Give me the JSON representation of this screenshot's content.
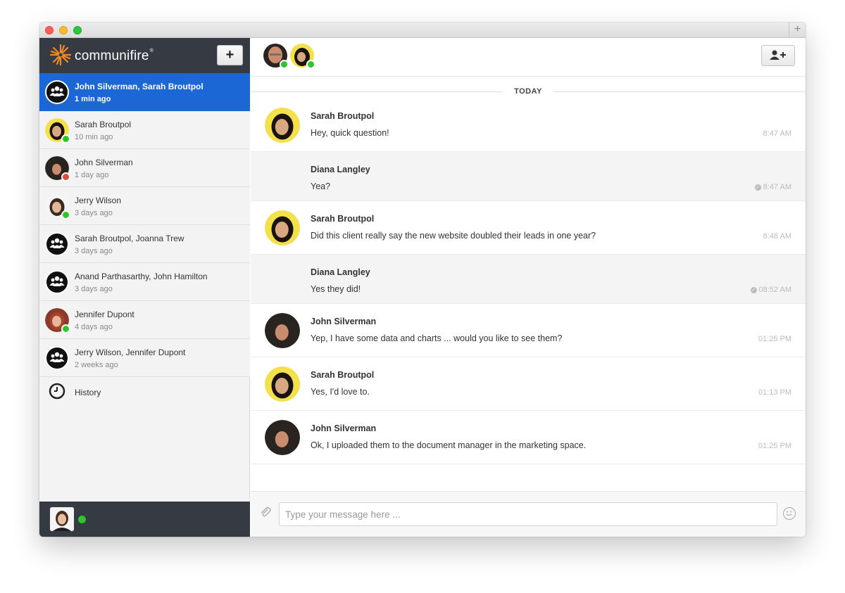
{
  "app": {
    "name": "communifire",
    "trademark": "®"
  },
  "colors": {
    "accent": "#1b67d6",
    "sidebar_dark": "#363b43",
    "online": "#2ec42e",
    "busy": "#e04a3a",
    "logo": "#f08a24"
  },
  "sidebar": {
    "add_label": "+",
    "conversations": [
      {
        "name": "John Silverman, Sarah Broutpol",
        "time": "1 min ago",
        "type": "group",
        "active": true
      },
      {
        "name": "Sarah Broutpol",
        "time": "10 min ago",
        "type": "person",
        "status": "online"
      },
      {
        "name": "John Silverman",
        "time": "1 day ago",
        "type": "person",
        "status": "busy"
      },
      {
        "name": "Jerry Wilson",
        "time": "3 days ago",
        "type": "person",
        "status": "online"
      },
      {
        "name": "Sarah Broutpol, Joanna Trew",
        "time": "3 days ago",
        "type": "group"
      },
      {
        "name": "Anand Parthasarthy, John Hamilton",
        "time": "3 days ago",
        "type": "group"
      },
      {
        "name": "Jennifer Dupont",
        "time": "4 days ago",
        "type": "person",
        "status": "online"
      },
      {
        "name": "Jerry Wilson, Jennifer Dupont",
        "time": "2 weeks ago",
        "type": "group"
      }
    ],
    "history_label": "History",
    "me_status": "online"
  },
  "chat": {
    "add_participant_icon": "add-user-icon",
    "date_divider": "TODAY",
    "messages": [
      {
        "sender": "Sarah Broutpol",
        "text": "Hey, quick question!",
        "time": "8:47 AM",
        "avatar": true,
        "alt": false,
        "read": false
      },
      {
        "sender": "Diana Langley",
        "text": "Yea?",
        "time": "8:47 AM",
        "avatar": false,
        "alt": true,
        "read": true
      },
      {
        "sender": "Sarah Broutpol",
        "text": "Did this client really say the new website doubled their leads in one year?",
        "time": "8:48 AM",
        "avatar": true,
        "alt": false,
        "read": false
      },
      {
        "sender": "Diana Langley",
        "text": "Yes they did!",
        "time": "08:52 AM",
        "avatar": false,
        "alt": true,
        "read": true
      },
      {
        "sender": "John Silverman",
        "text": "Yep, I have some data and charts ... would you like to see them?",
        "time": "01:25 PM",
        "avatar": true,
        "alt": false,
        "read": false
      },
      {
        "sender": "Sarah Broutpol",
        "text": "Yes, I'd love to.",
        "time": "01:13 PM",
        "avatar": true,
        "alt": false,
        "read": false
      },
      {
        "sender": "John Silverman",
        "text": "Ok, I uploaded them to the document manager in the marketing space.",
        "time": "01:25 PM",
        "avatar": true,
        "alt": false,
        "read": false
      }
    ]
  },
  "composer": {
    "placeholder": "Type your message here ...",
    "value": ""
  }
}
